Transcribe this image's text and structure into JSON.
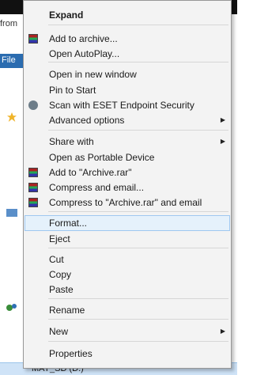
{
  "background": {
    "window_fragment_1": "from",
    "window_fragment_2": "File",
    "drive_label": "MAY_SD (D:)"
  },
  "menu": {
    "items": [
      {
        "label": "Expand",
        "bold": true
      },
      {
        "label": "Add to archive...",
        "icon": "winrar-icon"
      },
      {
        "label": "Open AutoPlay..."
      },
      {
        "label": "Open in new window"
      },
      {
        "label": "Pin to Start"
      },
      {
        "label": "Scan with ESET Endpoint Security",
        "icon": "eset-icon"
      },
      {
        "label": "Advanced options",
        "submenu": true
      },
      {
        "label": "Share with",
        "submenu": true
      },
      {
        "label": "Open as Portable Device"
      },
      {
        "label": "Add to \"Archive.rar\"",
        "icon": "winrar-icon"
      },
      {
        "label": "Compress and email...",
        "icon": "winrar-icon"
      },
      {
        "label": "Compress to \"Archive.rar\" and email",
        "icon": "winrar-icon"
      },
      {
        "label": "Format...",
        "highlighted": true
      },
      {
        "label": "Eject"
      },
      {
        "label": "Cut"
      },
      {
        "label": "Copy"
      },
      {
        "label": "Paste"
      },
      {
        "label": "Rename"
      },
      {
        "label": "New",
        "submenu": true
      },
      {
        "label": "Properties"
      }
    ],
    "submenu_arrow": "▶",
    "colors": {
      "menu_bg": "#f3f3f3",
      "highlight_bg": "#e5f1fb",
      "highlight_border": "#9fc8f0"
    }
  }
}
